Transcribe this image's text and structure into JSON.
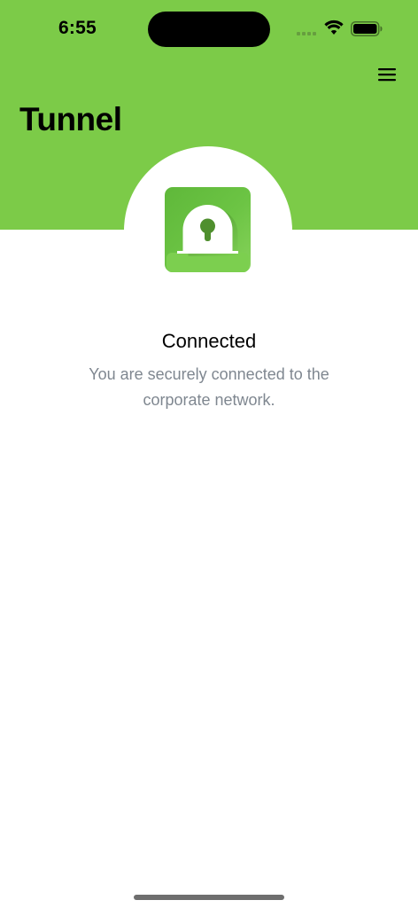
{
  "status_bar": {
    "time": "6:55",
    "wifi_icon": "wifi-icon",
    "battery_icon": "battery-full-icon"
  },
  "header": {
    "title": "Tunnel",
    "menu_icon": "hamburger-menu-icon",
    "background_color": "#7ccb48"
  },
  "connection": {
    "icon": "keyhole-lock-icon",
    "status": "Connected",
    "description": "You are securely connected to the corporate network."
  }
}
